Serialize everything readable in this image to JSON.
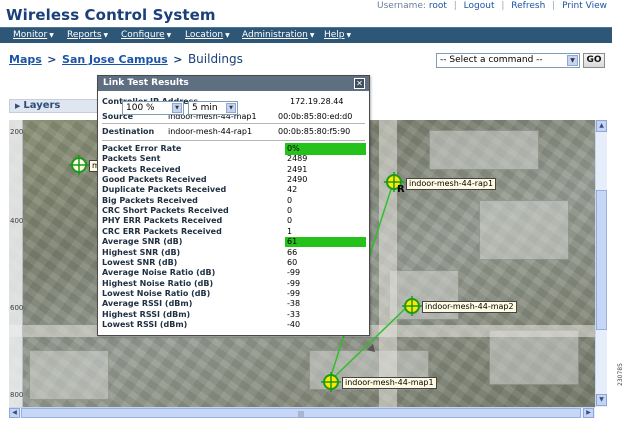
{
  "header": {
    "app_title": "Wireless Control System",
    "username_label": "Username:",
    "username": "root",
    "logout": "Logout",
    "refresh": "Refresh",
    "print_view": "Print View",
    "separator": "|"
  },
  "menu": {
    "items": [
      {
        "label": "Monitor"
      },
      {
        "label": "Reports"
      },
      {
        "label": "Configure"
      },
      {
        "label": "Location"
      },
      {
        "label": "Administration"
      },
      {
        "label": "Help"
      }
    ],
    "arrow": "▼"
  },
  "breadcrumb": {
    "maps": "Maps",
    "campus": "San Jose Campus",
    "current": "Buildings",
    "sep": ">"
  },
  "command": {
    "selected": "-- Select a command --",
    "go": "GO"
  },
  "layers": {
    "label": "Layers",
    "arrow": "▶"
  },
  "map_controls": {
    "zoom": "100 %",
    "interval": "5 min"
  },
  "ruler": {
    "ticks": [
      "200",
      "400",
      "600",
      "800"
    ]
  },
  "access_points": [
    {
      "name": "indoor-mesh-44-rap1"
    },
    {
      "name": "indoor-mesh-44-map2"
    },
    {
      "name": "indoor-mesh-44-map1"
    },
    {
      "name": "m"
    }
  ],
  "rap_marker": "R",
  "dialog": {
    "title": "Link Test Results",
    "close": "✕",
    "controller_label": "Controller IP Address",
    "controller_ip": "172.19.28.44",
    "source_label": "Source",
    "source_name": "indoor-mesh-44-map1",
    "source_mac": "00:0b:85:80:ed:d0",
    "destination_label": "Destination",
    "destination_name": "indoor-mesh-44-rap1",
    "destination_mac": "00:0b:85:80:f5:90",
    "stats": [
      {
        "label": "Packet Error Rate",
        "value": "0%",
        "highlight": true
      },
      {
        "label": "Packets Sent",
        "value": "2489"
      },
      {
        "label": "Packets Received",
        "value": "2491"
      },
      {
        "label": "Good Packets Received",
        "value": "2490"
      },
      {
        "label": "Duplicate Packets Received",
        "value": "42"
      },
      {
        "label": "Big Packets Received",
        "value": "0"
      },
      {
        "label": "CRC Short Packets Received",
        "value": "0"
      },
      {
        "label": "PHY ERR Packets Received",
        "value": "0"
      },
      {
        "label": "CRC ERR Packets Received",
        "value": "1"
      },
      {
        "label": "Average SNR (dB)",
        "value": "61",
        "highlight": true
      },
      {
        "label": "Highest SNR (dB)",
        "value": "66"
      },
      {
        "label": "Lowest SNR (dB)",
        "value": "60"
      },
      {
        "label": "Average Noise Ratio (dB)",
        "value": "-99"
      },
      {
        "label": "Highest Noise Ratio (dB)",
        "value": "-99"
      },
      {
        "label": "Lowest Noise Ratio (dB)",
        "value": "-99"
      },
      {
        "label": "Average RSSI (dBm)",
        "value": "-38"
      },
      {
        "label": "Highest RSSI (dBm)",
        "value": "-33"
      },
      {
        "label": "Lowest RSSI (dBm)",
        "value": "-40"
      }
    ]
  },
  "colors": {
    "highlight_green": "#26c21c",
    "link_line": "#2fbf2a",
    "title_blue": "#1b3f78"
  },
  "figure_code": "230785"
}
